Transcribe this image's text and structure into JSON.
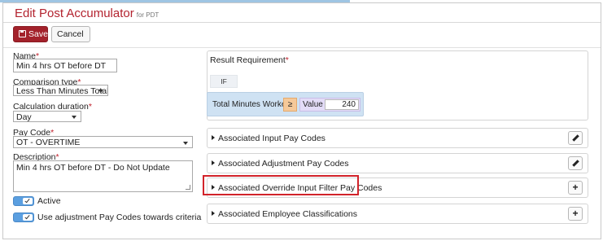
{
  "header": {
    "title": "Edit Post Accumulator",
    "subtitle": "for PDT"
  },
  "toolbar": {
    "save_label": "Save",
    "cancel_label": "Cancel"
  },
  "form": {
    "name_label": "Name",
    "name_value": "Min 4 hrs OT before DT",
    "comparison_label": "Comparison type",
    "comparison_value": "Less Than Minutes Total",
    "duration_label": "Calculation duration",
    "duration_value": "Day",
    "paycode_label": "Pay Code",
    "paycode_value": "OT - OVERTIME",
    "description_label": "Description",
    "description_value": "Min 4 hrs OT before DT - Do Not Update",
    "active_label": "Active",
    "use_adjustment_label": "Use adjustment Pay Codes towards criteria",
    "required_mark": "*"
  },
  "result_requirement": {
    "title": "Result Requirement",
    "if_label": "IF",
    "condition_label": "Total Minutes Worked",
    "operator": "≥",
    "value_label": "Value",
    "value": "240"
  },
  "accordions": [
    {
      "label": "Associated Input Pay Codes",
      "action": "✎"
    },
    {
      "label": "Associated Adjustment Pay Codes",
      "action": "✎"
    },
    {
      "label": "Associated Override Input Filter Pay Codes",
      "action": "+"
    },
    {
      "label": "Associated Employee Classifications",
      "action": "+"
    }
  ],
  "colors": {
    "accent": "#a3222b",
    "title_red": "#b3232f",
    "condition_bg": "#cfe2f3",
    "toggle_blue": "#5b9fe0",
    "highlight": "#d2232a"
  }
}
